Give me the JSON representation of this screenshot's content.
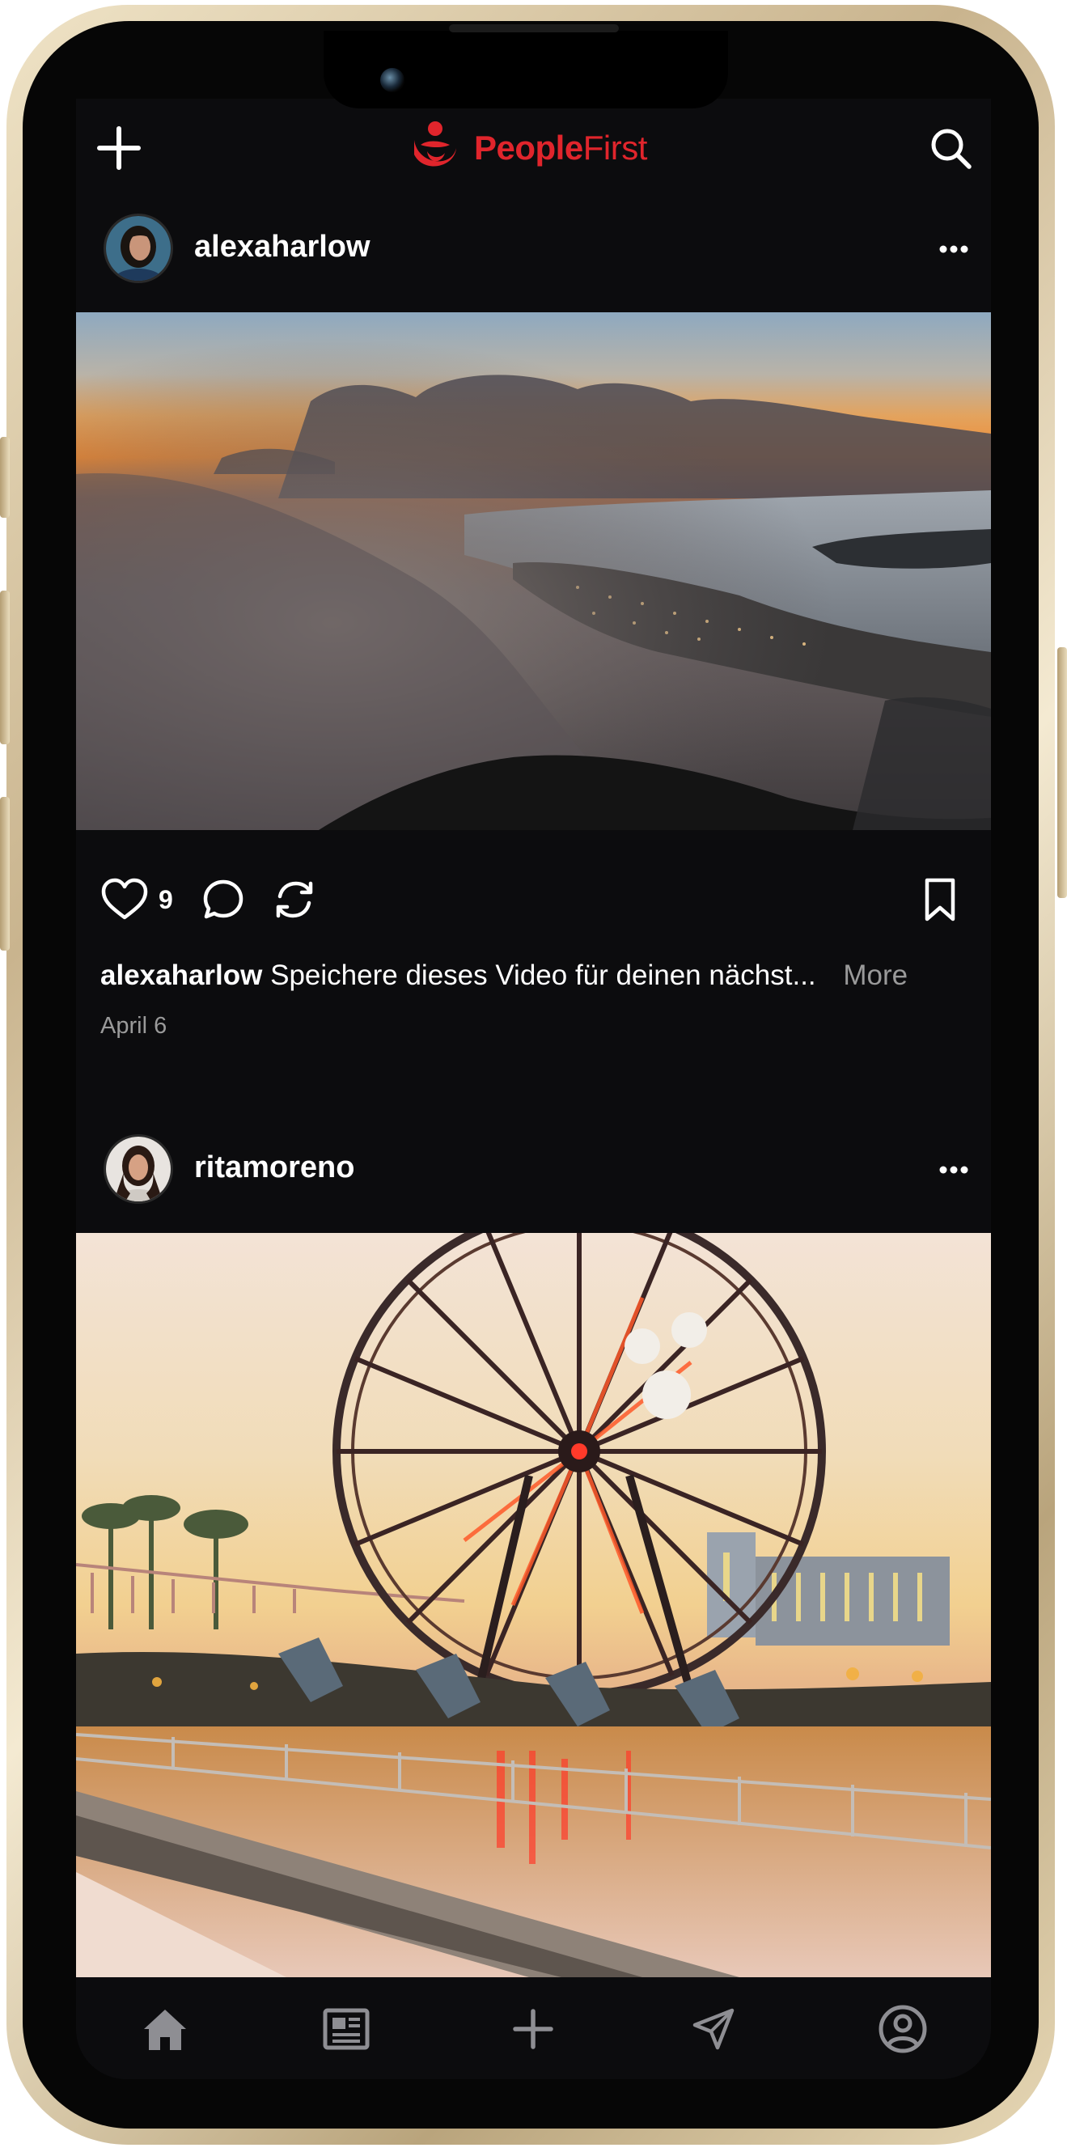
{
  "app": {
    "logo_bold": "People",
    "logo_light": "First",
    "brand_color": "#e0252c"
  },
  "topbar": {
    "left_icon": "plus-icon",
    "right_icon": "search-icon"
  },
  "posts": [
    {
      "username": "alexaharlow",
      "likes": "9",
      "caption_user": "alexaharlow",
      "caption_text": "Speichere dieses Video für deinen nächst...",
      "more_label": "More",
      "date": "April 6"
    },
    {
      "username": "ritamoreno"
    }
  ],
  "tabbar": {
    "items": [
      "home-icon",
      "news-icon",
      "plus-icon",
      "send-icon",
      "profile-icon"
    ],
    "active": "home-icon"
  }
}
